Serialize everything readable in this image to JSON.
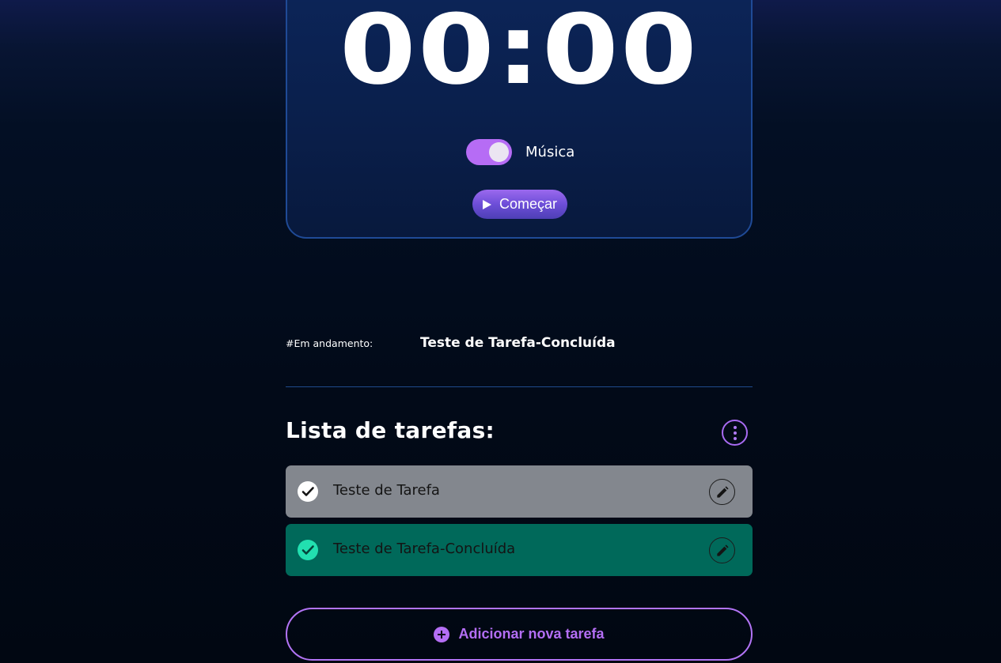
{
  "timer": {
    "display": "00:00",
    "music_label": "Música",
    "music_enabled": true,
    "start_label": "Começar"
  },
  "in_progress": {
    "label": "#Em andamento:",
    "task": "Teste de Tarefa-Concluída"
  },
  "task_list": {
    "title": "Lista de tarefas:",
    "items": [
      {
        "label": "Teste de Tarefa",
        "completed": false
      },
      {
        "label": "Teste de Tarefa-Concluída",
        "completed": true
      }
    ],
    "add_label": "Adicionar nova tarefa"
  },
  "colors": {
    "accent": "#b46ef4",
    "task_default": "#83878e",
    "task_completed": "#00695a",
    "check_completed": "#22e0b0",
    "card_border": "#1f4a96"
  },
  "icons": {
    "play": "play-icon",
    "check": "check-icon",
    "edit": "pencil-icon",
    "menu": "more-vertical-icon",
    "add": "plus-circle-icon"
  }
}
